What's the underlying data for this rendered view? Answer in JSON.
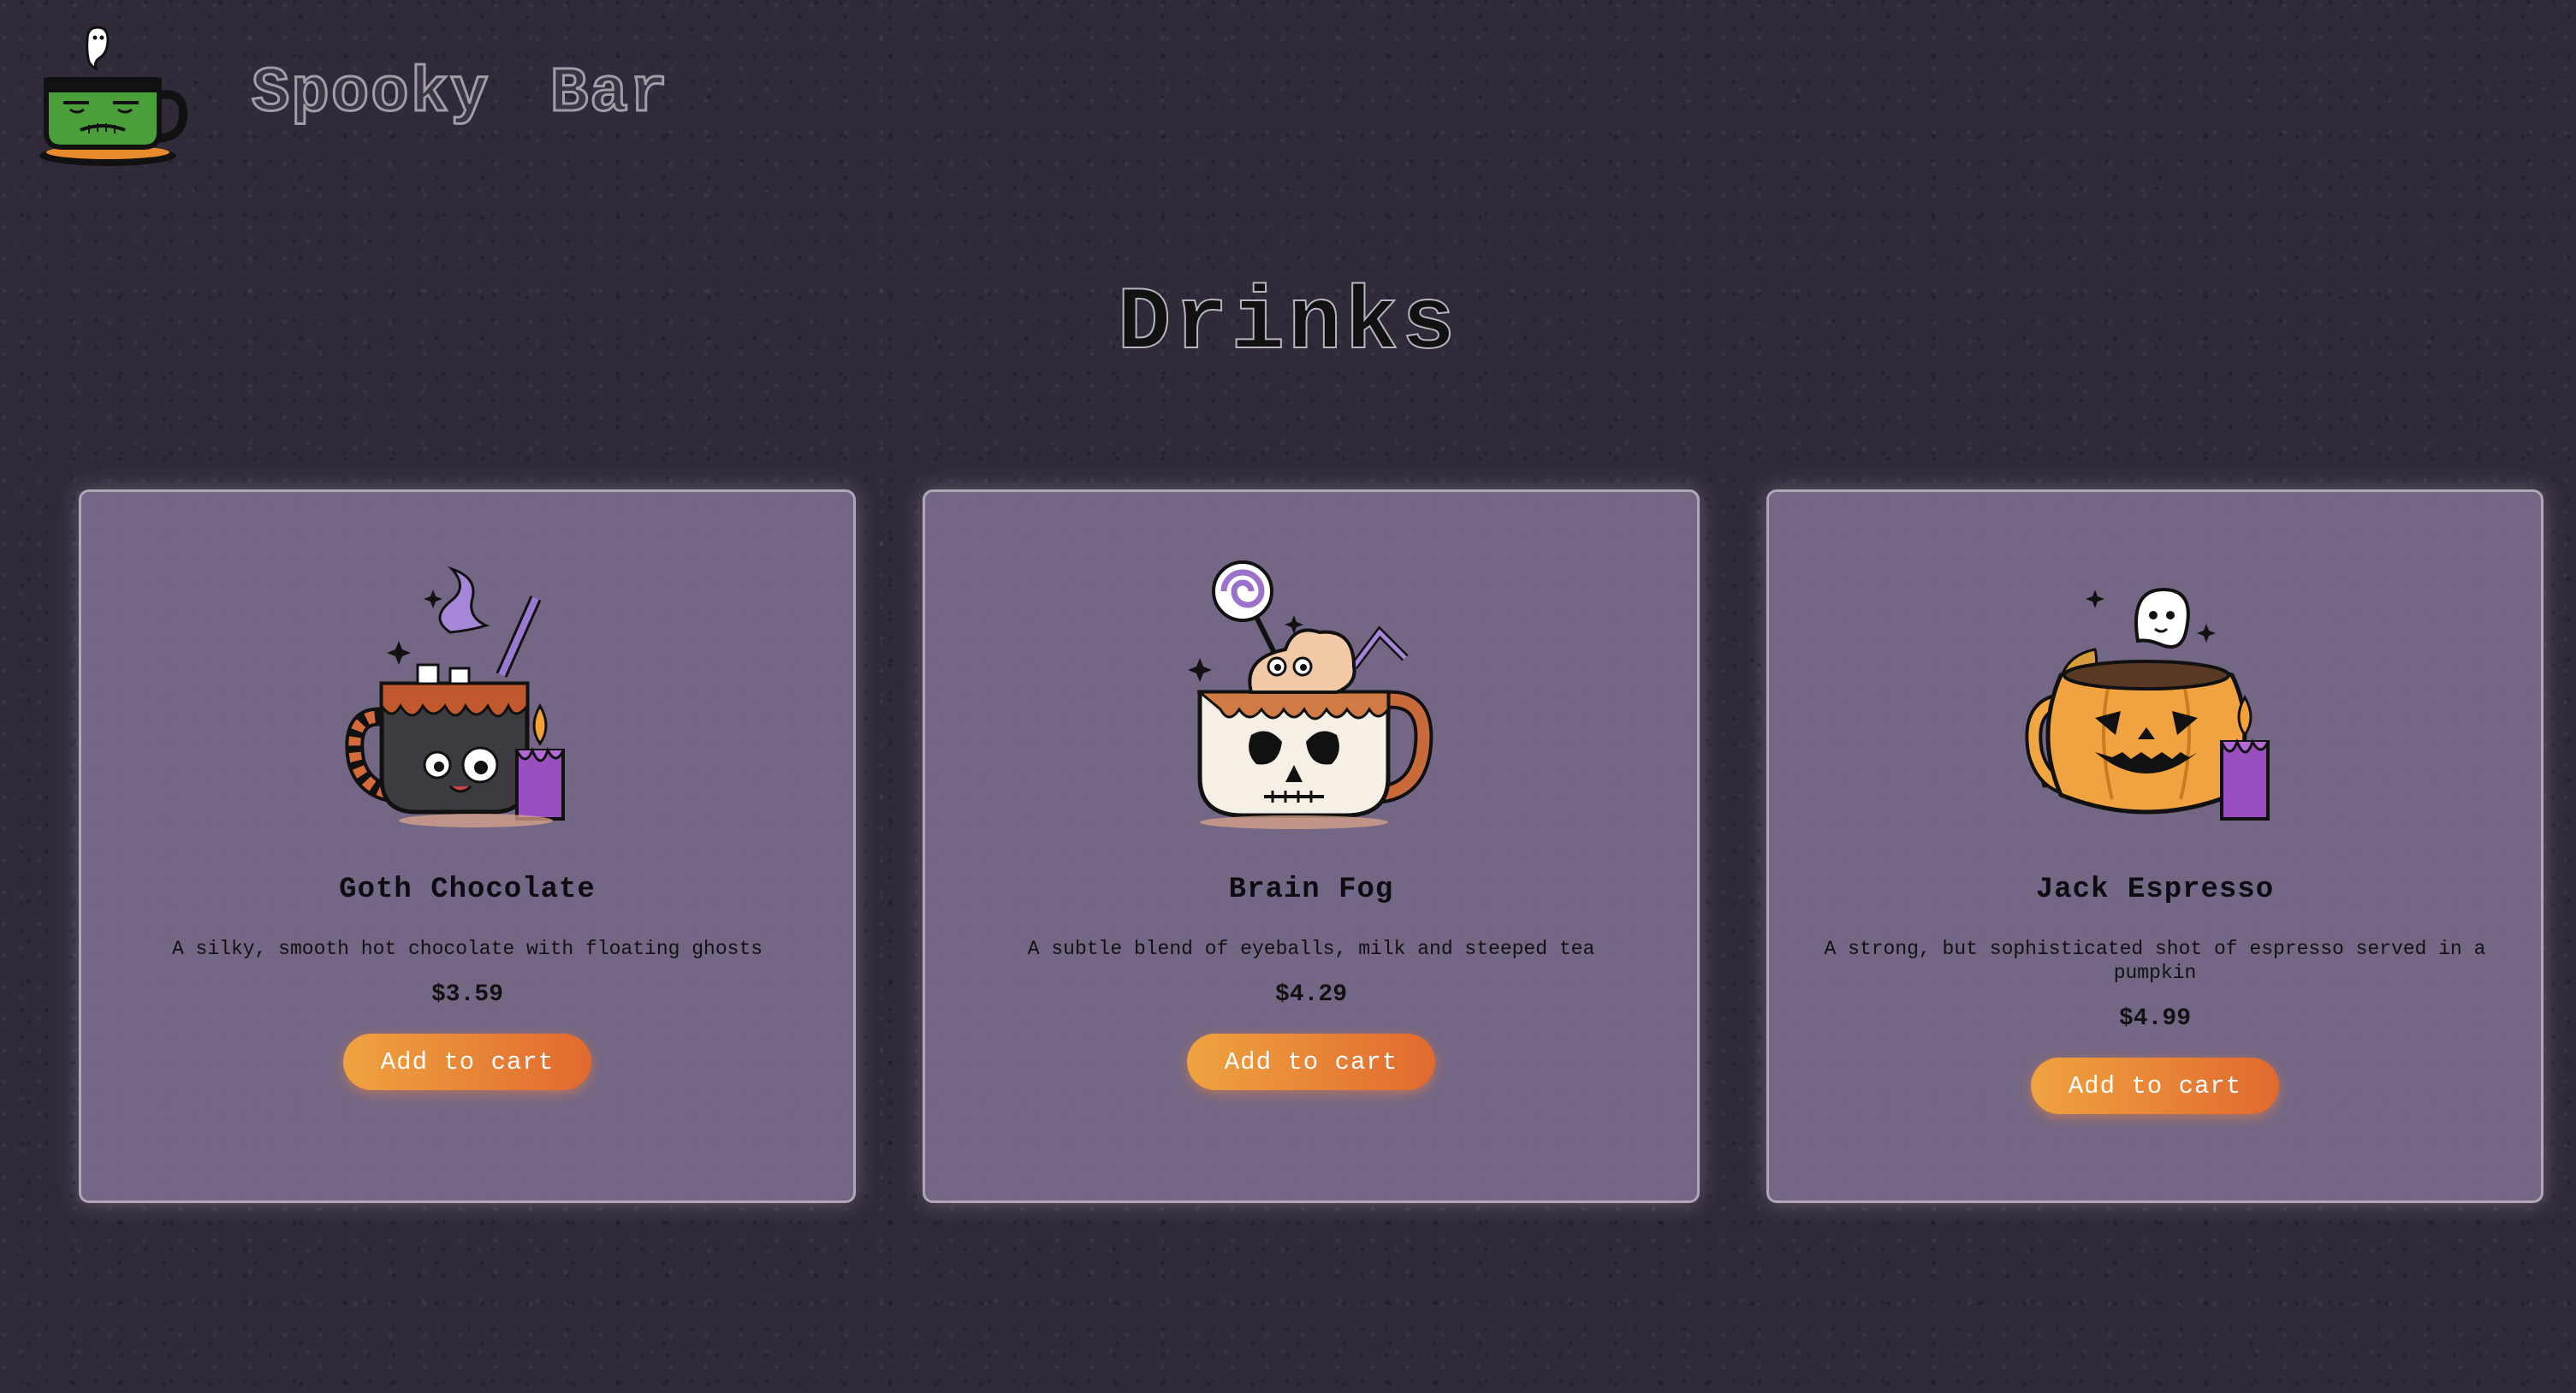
{
  "header": {
    "logo_icon": "frankenstein-teacup-logo",
    "brand_name": "Spooky Bar"
  },
  "page_title": "Drinks",
  "products": [
    {
      "name": "Goth Chocolate",
      "description": "A silky, smooth hot chocolate with floating ghosts",
      "price": "$3.59",
      "cta": "Add to cart",
      "icon": "spooky-hot-chocolate-mug-icon"
    },
    {
      "name": "Brain Fog",
      "description": "A subtle blend of eyeballs, milk and steeped tea",
      "price": "$4.29",
      "cta": "Add to cart",
      "icon": "skull-mug-icon"
    },
    {
      "name": "Jack Espresso",
      "description": "A strong, but sophisticated shot of espresso served in a pumpkin",
      "price": "$4.99",
      "cta": "Add to cart",
      "icon": "pumpkin-mug-icon"
    }
  ],
  "colors": {
    "background": "#312a39",
    "card": "#7a6d8c",
    "button_start": "#efa340",
    "button_end": "#e1692f"
  }
}
